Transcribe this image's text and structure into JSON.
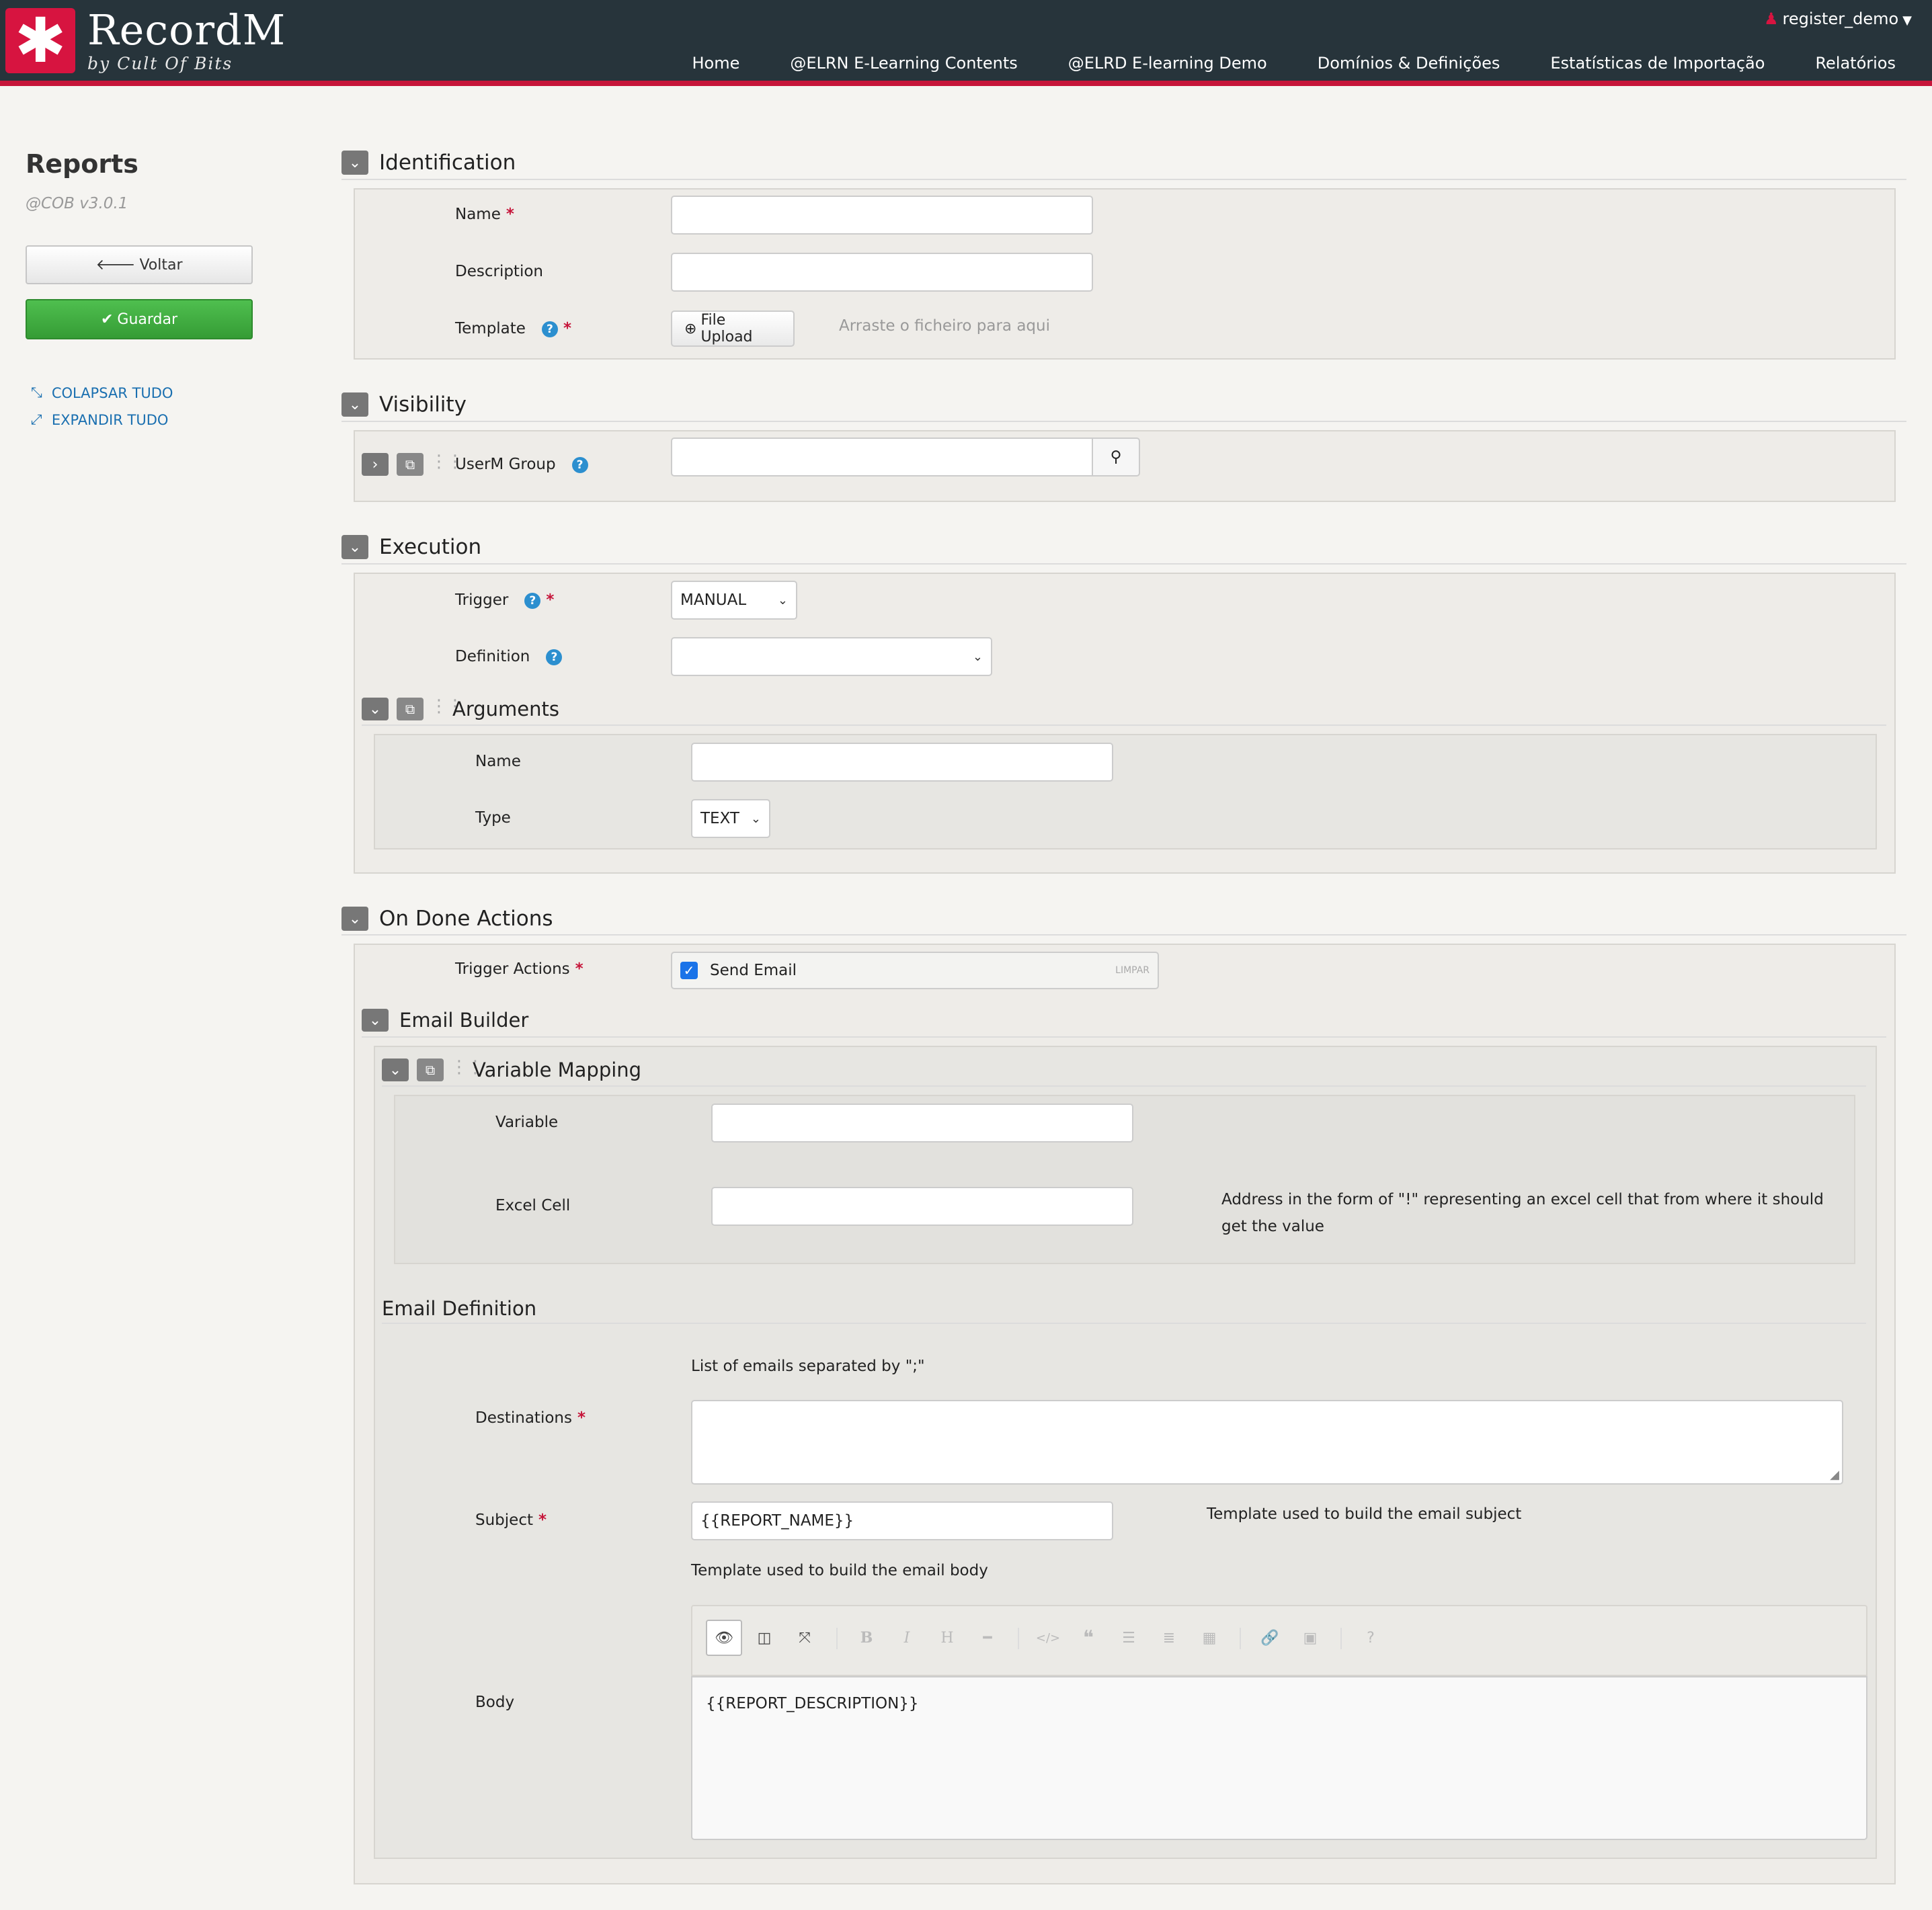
{
  "app": {
    "brand": "RecordM",
    "brand_sub": "by Cult Of Bits",
    "logo_glyph": "✱",
    "user": "register_demo",
    "nav": [
      "Home",
      "@ELRN E-Learning Contents",
      "@ELRD E-learning Demo",
      "Domínios & Definições",
      "Estatísticas de Importação",
      "Relatórios"
    ]
  },
  "sidebar": {
    "title": "Reports",
    "version": "@COB v3.0.1",
    "back_label": "Voltar",
    "save_label": "Guardar",
    "collapse_label": "COLAPSAR TUDO",
    "expand_label": "EXPANDIR TUDO"
  },
  "identification": {
    "title": "Identification",
    "name_label": "Name",
    "description_label": "Description",
    "template_label": "Template",
    "file_upload_label": "File Upload",
    "drop_hint": "Arraste o ficheiro para aqui"
  },
  "visibility": {
    "title": "Visibility",
    "group_label": "UserM Group"
  },
  "execution": {
    "title": "Execution",
    "trigger_label": "Trigger",
    "trigger_value": "MANUAL",
    "definition_label": "Definition",
    "arguments_title": "Arguments",
    "arg_name_label": "Name",
    "arg_type_label": "Type",
    "arg_type_value": "TEXT"
  },
  "on_done": {
    "title": "On Done Actions",
    "trigger_actions_label": "Trigger Actions",
    "send_email_label": "Send Email",
    "clear_label": "LIMPAR",
    "email_builder_title": "Email Builder",
    "variable_mapping_title": "Variable Mapping",
    "variable_label": "Variable",
    "excel_cell_label": "Excel Cell",
    "excel_cell_hint": "Address in the form of \"!\" representing an excel cell that from where it should get the value",
    "email_definition_title": "Email Definition",
    "destinations_hint": "List of emails separated by \";\"",
    "destinations_label": "Destinations",
    "subject_label": "Subject",
    "subject_value": "{{REPORT_NAME}}",
    "subject_hint": "Template used to build the email subject",
    "body_hint": "Template used to build the email body",
    "body_label": "Body",
    "body_value": "{{REPORT_DESCRIPTION}}"
  }
}
